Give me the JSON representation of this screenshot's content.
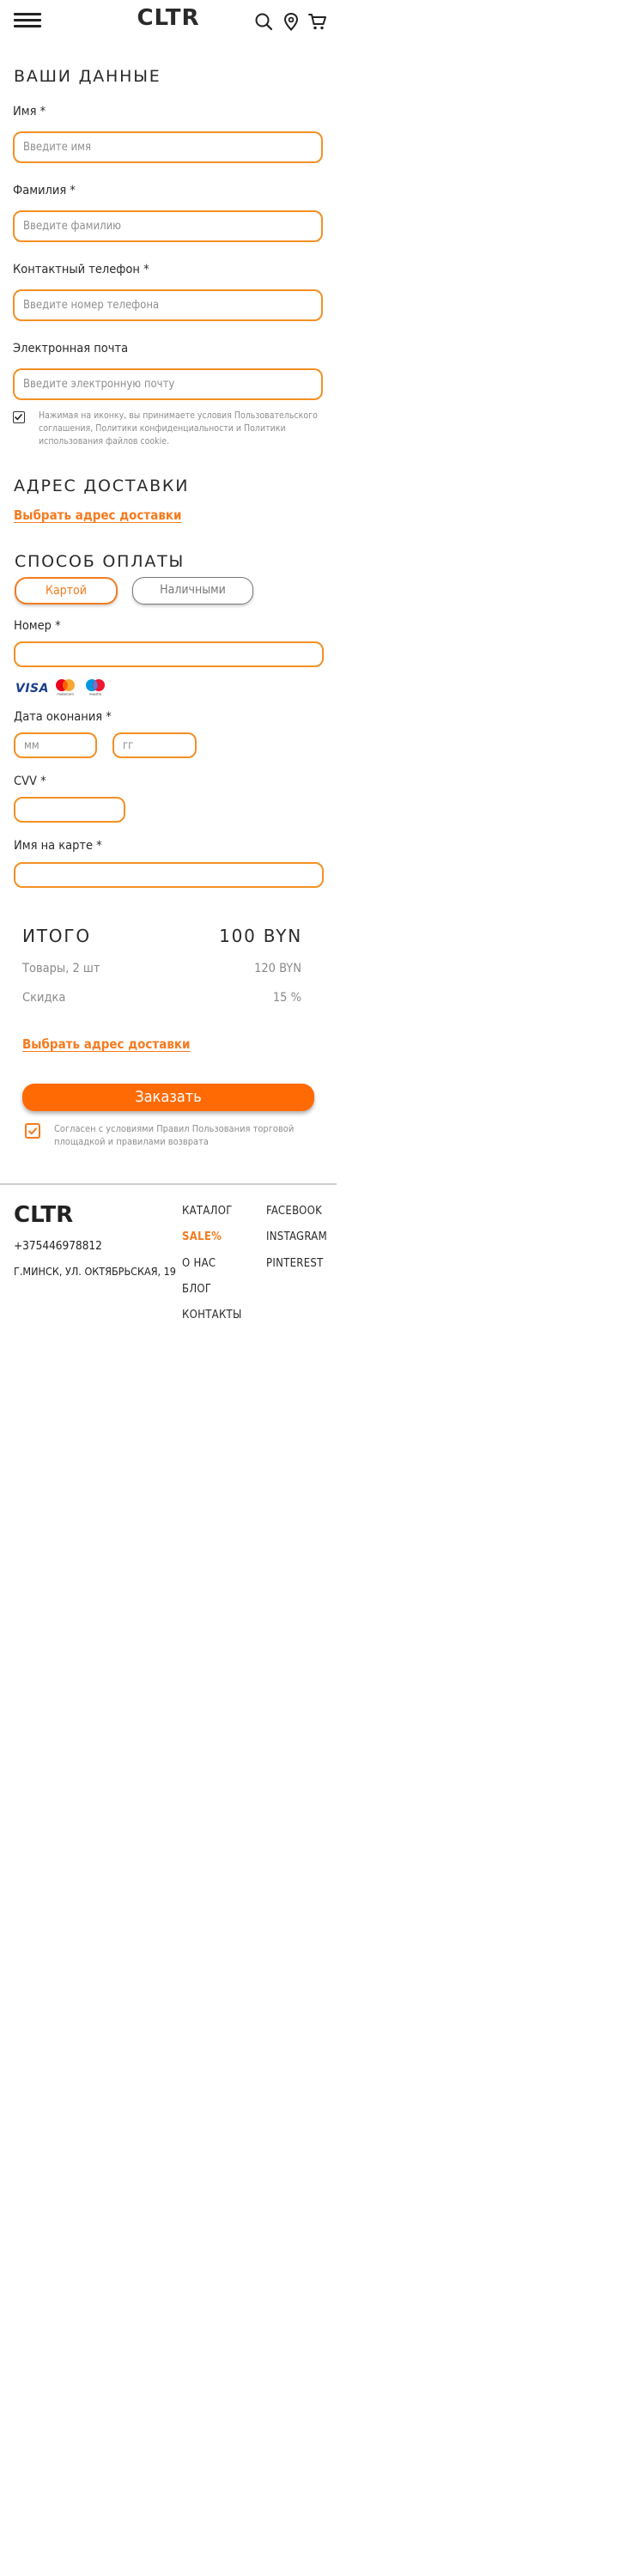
{
  "header": {
    "logo": "CLTR"
  },
  "personal": {
    "title": "ВАШИ ДАННЫЕ",
    "first_name_label": "Имя *",
    "first_name_placeholder": "Введите имя",
    "last_name_label": "Фамилия *",
    "last_name_placeholder": "Введите фамилию",
    "phone_label": "Контактный телефон *",
    "phone_placeholder": "Введите номер телефона",
    "email_label": "Электронная почта",
    "email_placeholder": "Введите электронную почту",
    "consent_text": "Нажимая на иконку, вы принимаете условия Пользовательского соглашения, Политики конфиденциальности и Политики использования файлов cookie."
  },
  "delivery": {
    "title": "АДРЕС ДОСТАВКИ",
    "choose_link": "Выбрать адрес доставки"
  },
  "payment": {
    "title": "СПОСОБ ОПЛАТЫ",
    "card_option": "Картой",
    "cash_option": "Наличными",
    "number_label": "Номер *",
    "brands": [
      "VISA",
      "mastercard",
      "maestro"
    ],
    "expiry_label": "Дата оконания *",
    "month_placeholder": "мм",
    "year_placeholder": "гг",
    "cvv_label": "CVV *",
    "cardholder_label": "Имя на карте *"
  },
  "summary": {
    "title": "ИТОГО",
    "total": "100 BYN",
    "items_label": "Товары, 2 шт",
    "items_value": "120 BYN",
    "discount_label": "Скидка",
    "discount_value": "15 %",
    "choose_link": "Выбрать адрес доставки",
    "order_button": "Заказать",
    "agree_text": "Согласен с условиями Правил Пользования торговой площадкой и правилами возврата"
  },
  "footer": {
    "logo": "CLTR",
    "phone": "+375446978812",
    "address": "Г.МИНСК, УЛ. ОКТЯБРЬСКАЯ, 19",
    "menu": [
      "КАТАЛОГ",
      "SALE%",
      "О НАС",
      "БЛОГ",
      "КОНТАКТЫ"
    ],
    "social": [
      "FACEBOOK",
      "INSTAGRAM",
      "PINTEREST"
    ]
  },
  "colors": {
    "accent": "#f47b20",
    "button": "#ff6a05",
    "text": "#2a2a2a",
    "muted": "#8a8a8a"
  }
}
